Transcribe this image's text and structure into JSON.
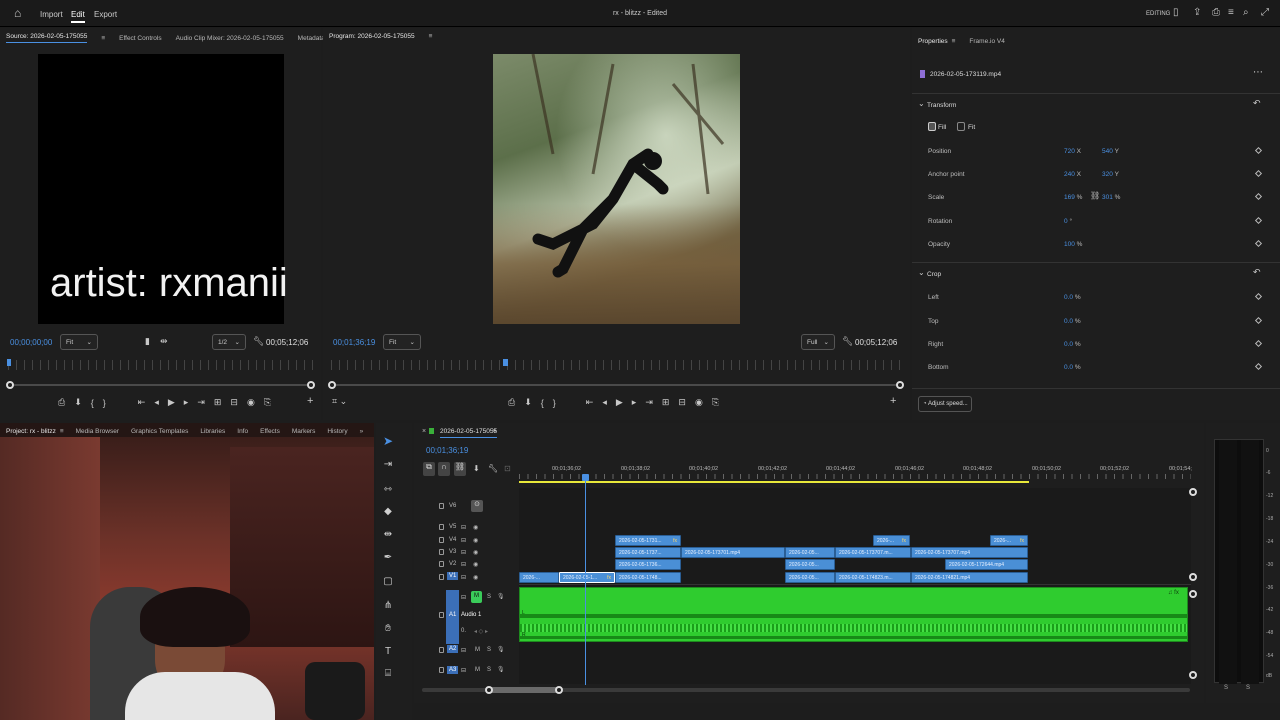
{
  "topbar": {
    "home_icon": "home-icon",
    "menu": [
      "Import",
      "Edit",
      "Export"
    ],
    "active_menu": "Edit",
    "title": "rx - blitzz - Edited",
    "workspace": "EDITING"
  },
  "source_panel": {
    "tabs": [
      "Source: 2026-02-05-175055",
      "Effect Controls",
      "Audio Clip Mixer: 2026-02-05-175055",
      "Metadata"
    ],
    "overlay_text": "artist: rxmanii",
    "timecode_in": "00;00;00;00",
    "fit": "Fit",
    "resolution": "1/2",
    "duration": "00;05;12;06"
  },
  "program_panel": {
    "tab": "Program: 2026-02-05-175055",
    "timecode": "00;01;36;19",
    "fit": "Fit",
    "quality": "Full",
    "duration": "00;05;12;06"
  },
  "properties_panel": {
    "tabs": [
      "Properties",
      "Frame.io V4"
    ],
    "clip_name": "2026-02-05-173119.mp4",
    "transform_label": "Transform",
    "fill_label": "Fill",
    "fit_label": "Fit",
    "rows": [
      {
        "label": "Position",
        "v1": "720",
        "u1": "X",
        "v2": "540",
        "u2": "Y"
      },
      {
        "label": "Anchor point",
        "v1": "240",
        "u1": "X",
        "v2": "320",
        "u2": "Y"
      },
      {
        "label": "Scale",
        "v1": "169",
        "u1": "%",
        "v2": "301",
        "u2": "%"
      },
      {
        "label": "Rotation",
        "v1": "0",
        "u1": "°",
        "v2": "",
        "u2": ""
      },
      {
        "label": "Opacity",
        "v1": "100",
        "u1": "%",
        "v2": "",
        "u2": ""
      }
    ],
    "crop_label": "Crop",
    "crop_rows": [
      {
        "label": "Left",
        "value": "0.0",
        "unit": "%"
      },
      {
        "label": "Top",
        "value": "0.0",
        "unit": "%"
      },
      {
        "label": "Right",
        "value": "0.0",
        "unit": "%"
      },
      {
        "label": "Bottom",
        "value": "0.0",
        "unit": "%"
      }
    ],
    "adjust_speed": "Adjust speed..."
  },
  "project_panel": {
    "tabs": [
      "Project: rx - blitzz",
      "Media Browser",
      "Graphics Templates",
      "Libraries",
      "Info",
      "Effects",
      "Markers",
      "History"
    ]
  },
  "timeline": {
    "sequence_tab": "2026-02-05-175055",
    "timecode": "00;01;36;19",
    "ruler_times": [
      "00;01;36;02",
      "00;01;38;02",
      "00;01;40;02",
      "00;01;42;02",
      "00;01;44;02",
      "00;01;46;02",
      "00;01;48;02",
      "00;01;50;02",
      "00;01;52;02",
      "00;01;54;"
    ],
    "video_tracks": [
      "V6",
      "V5",
      "V4",
      "V3",
      "V2",
      "V1"
    ],
    "audio_tracks": [
      "A1",
      "A2",
      "A3"
    ],
    "audio1_name": "Audio 1",
    "clips": [
      {
        "track": "V4",
        "label": "2026-02-05-1731...",
        "fx": "fx"
      },
      {
        "track": "V4",
        "label": "2026-...",
        "fx": "fx"
      },
      {
        "track": "V4",
        "label": "2026-...",
        "fx": "fx"
      },
      {
        "track": "V3",
        "label": "2026-02-05-1737...",
        "fx": ""
      },
      {
        "track": "V3",
        "label": "2026-02-05-173701.mp4",
        "fx": ""
      },
      {
        "track": "V3",
        "label": "2026-02-05...",
        "fx": ""
      },
      {
        "track": "V3",
        "label": "2026-02-05-173707.m...",
        "fx": ""
      },
      {
        "track": "V3",
        "label": "2026-02-05-173707.mp4",
        "fx": ""
      },
      {
        "track": "V2",
        "label": "2026-02-05-1736...",
        "fx": ""
      },
      {
        "track": "V2",
        "label": "2026-02-05...",
        "fx": ""
      },
      {
        "track": "V2",
        "label": "2026-02-05-172644.mp4",
        "fx": ""
      },
      {
        "track": "V1",
        "label": "2026-...",
        "fx": ""
      },
      {
        "track": "V1",
        "label": "2026-02-05-1...",
        "fx": "fx"
      },
      {
        "track": "V1",
        "label": "2026-02-05-1748...",
        "fx": ""
      },
      {
        "track": "V1",
        "label": "2026-02-05...",
        "fx": ""
      },
      {
        "track": "V1",
        "label": "2026-02-05-174823.m...",
        "fx": ""
      },
      {
        "track": "V1",
        "label": "2026-02-05-174821.mp4",
        "fx": ""
      }
    ]
  },
  "audio_meter": {
    "scale": [
      "0",
      "-6",
      "-12",
      "-18",
      "-24",
      "-30",
      "-36",
      "-42",
      "-48",
      "-54",
      "dB"
    ],
    "footer": [
      "S",
      "S"
    ]
  },
  "colors": {
    "accent": "#4a90e2",
    "clip_blue": "#4a8fd6",
    "audio_green": "#2fcc2f",
    "timeline_yellow": "#e8e83a"
  }
}
